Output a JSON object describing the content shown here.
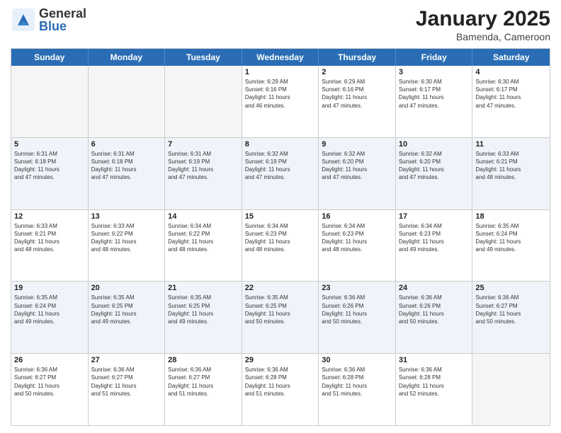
{
  "logo": {
    "general": "General",
    "blue": "Blue"
  },
  "title": "January 2025",
  "subtitle": "Bamenda, Cameroon",
  "days": [
    "Sunday",
    "Monday",
    "Tuesday",
    "Wednesday",
    "Thursday",
    "Friday",
    "Saturday"
  ],
  "weeks": [
    [
      {
        "day": "",
        "info": "",
        "empty": true
      },
      {
        "day": "",
        "info": "",
        "empty": true
      },
      {
        "day": "",
        "info": "",
        "empty": true
      },
      {
        "day": "1",
        "info": "Sunrise: 6:29 AM\nSunset: 6:16 PM\nDaylight: 11 hours\nand 46 minutes."
      },
      {
        "day": "2",
        "info": "Sunrise: 6:29 AM\nSunset: 6:16 PM\nDaylight: 11 hours\nand 47 minutes."
      },
      {
        "day": "3",
        "info": "Sunrise: 6:30 AM\nSunset: 6:17 PM\nDaylight: 11 hours\nand 47 minutes."
      },
      {
        "day": "4",
        "info": "Sunrise: 6:30 AM\nSunset: 6:17 PM\nDaylight: 11 hours\nand 47 minutes."
      }
    ],
    [
      {
        "day": "5",
        "info": "Sunrise: 6:31 AM\nSunset: 6:18 PM\nDaylight: 11 hours\nand 47 minutes."
      },
      {
        "day": "6",
        "info": "Sunrise: 6:31 AM\nSunset: 6:18 PM\nDaylight: 11 hours\nand 47 minutes."
      },
      {
        "day": "7",
        "info": "Sunrise: 6:31 AM\nSunset: 6:19 PM\nDaylight: 11 hours\nand 47 minutes."
      },
      {
        "day": "8",
        "info": "Sunrise: 6:32 AM\nSunset: 6:19 PM\nDaylight: 11 hours\nand 47 minutes."
      },
      {
        "day": "9",
        "info": "Sunrise: 6:32 AM\nSunset: 6:20 PM\nDaylight: 11 hours\nand 47 minutes."
      },
      {
        "day": "10",
        "info": "Sunrise: 6:32 AM\nSunset: 6:20 PM\nDaylight: 11 hours\nand 47 minutes."
      },
      {
        "day": "11",
        "info": "Sunrise: 6:33 AM\nSunset: 6:21 PM\nDaylight: 11 hours\nand 48 minutes."
      }
    ],
    [
      {
        "day": "12",
        "info": "Sunrise: 6:33 AM\nSunset: 6:21 PM\nDaylight: 11 hours\nand 48 minutes."
      },
      {
        "day": "13",
        "info": "Sunrise: 6:33 AM\nSunset: 6:22 PM\nDaylight: 11 hours\nand 48 minutes."
      },
      {
        "day": "14",
        "info": "Sunrise: 6:34 AM\nSunset: 6:22 PM\nDaylight: 11 hours\nand 48 minutes."
      },
      {
        "day": "15",
        "info": "Sunrise: 6:34 AM\nSunset: 6:23 PM\nDaylight: 11 hours\nand 48 minutes."
      },
      {
        "day": "16",
        "info": "Sunrise: 6:34 AM\nSunset: 6:23 PM\nDaylight: 11 hours\nand 48 minutes."
      },
      {
        "day": "17",
        "info": "Sunrise: 6:34 AM\nSunset: 6:23 PM\nDaylight: 11 hours\nand 49 minutes."
      },
      {
        "day": "18",
        "info": "Sunrise: 6:35 AM\nSunset: 6:24 PM\nDaylight: 11 hours\nand 49 minutes."
      }
    ],
    [
      {
        "day": "19",
        "info": "Sunrise: 6:35 AM\nSunset: 6:24 PM\nDaylight: 11 hours\nand 49 minutes."
      },
      {
        "day": "20",
        "info": "Sunrise: 6:35 AM\nSunset: 6:25 PM\nDaylight: 11 hours\nand 49 minutes."
      },
      {
        "day": "21",
        "info": "Sunrise: 6:35 AM\nSunset: 6:25 PM\nDaylight: 11 hours\nand 49 minutes."
      },
      {
        "day": "22",
        "info": "Sunrise: 6:35 AM\nSunset: 6:25 PM\nDaylight: 11 hours\nand 50 minutes."
      },
      {
        "day": "23",
        "info": "Sunrise: 6:36 AM\nSunset: 6:26 PM\nDaylight: 11 hours\nand 50 minutes."
      },
      {
        "day": "24",
        "info": "Sunrise: 6:36 AM\nSunset: 6:26 PM\nDaylight: 11 hours\nand 50 minutes."
      },
      {
        "day": "25",
        "info": "Sunrise: 6:36 AM\nSunset: 6:27 PM\nDaylight: 11 hours\nand 50 minutes."
      }
    ],
    [
      {
        "day": "26",
        "info": "Sunrise: 6:36 AM\nSunset: 6:27 PM\nDaylight: 11 hours\nand 50 minutes."
      },
      {
        "day": "27",
        "info": "Sunrise: 6:36 AM\nSunset: 6:27 PM\nDaylight: 11 hours\nand 51 minutes."
      },
      {
        "day": "28",
        "info": "Sunrise: 6:36 AM\nSunset: 6:27 PM\nDaylight: 11 hours\nand 51 minutes."
      },
      {
        "day": "29",
        "info": "Sunrise: 6:36 AM\nSunset: 6:28 PM\nDaylight: 11 hours\nand 51 minutes."
      },
      {
        "day": "30",
        "info": "Sunrise: 6:36 AM\nSunset: 6:28 PM\nDaylight: 11 hours\nand 51 minutes."
      },
      {
        "day": "31",
        "info": "Sunrise: 6:36 AM\nSunset: 6:28 PM\nDaylight: 11 hours\nand 52 minutes."
      },
      {
        "day": "",
        "info": "",
        "empty": true
      }
    ]
  ]
}
